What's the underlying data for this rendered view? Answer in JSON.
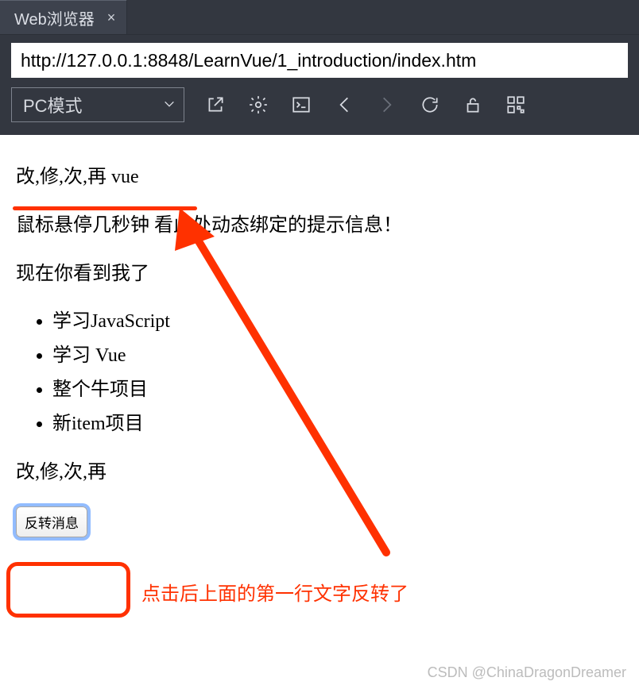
{
  "tab": {
    "title": "Web浏览器"
  },
  "url": "http://127.0.0.1:8848/LearnVue/1_introduction/index.htm",
  "mode_select": {
    "label": "PC模式"
  },
  "page": {
    "line1": "改,修,次,再 vue",
    "line2": "鼠标悬停几秒钟  看此处动态绑定的提示信息！",
    "line3": "现在你看到我了",
    "todos": [
      "学习JavaScript",
      "学习 Vue",
      "整个牛项目",
      "新item项目"
    ],
    "line4": "改,修,次,再",
    "button_label": "反转消息"
  },
  "annotation_text": "点击后上面的第一行文字反转了",
  "watermark": "CSDN @ChinaDragonDreamer"
}
